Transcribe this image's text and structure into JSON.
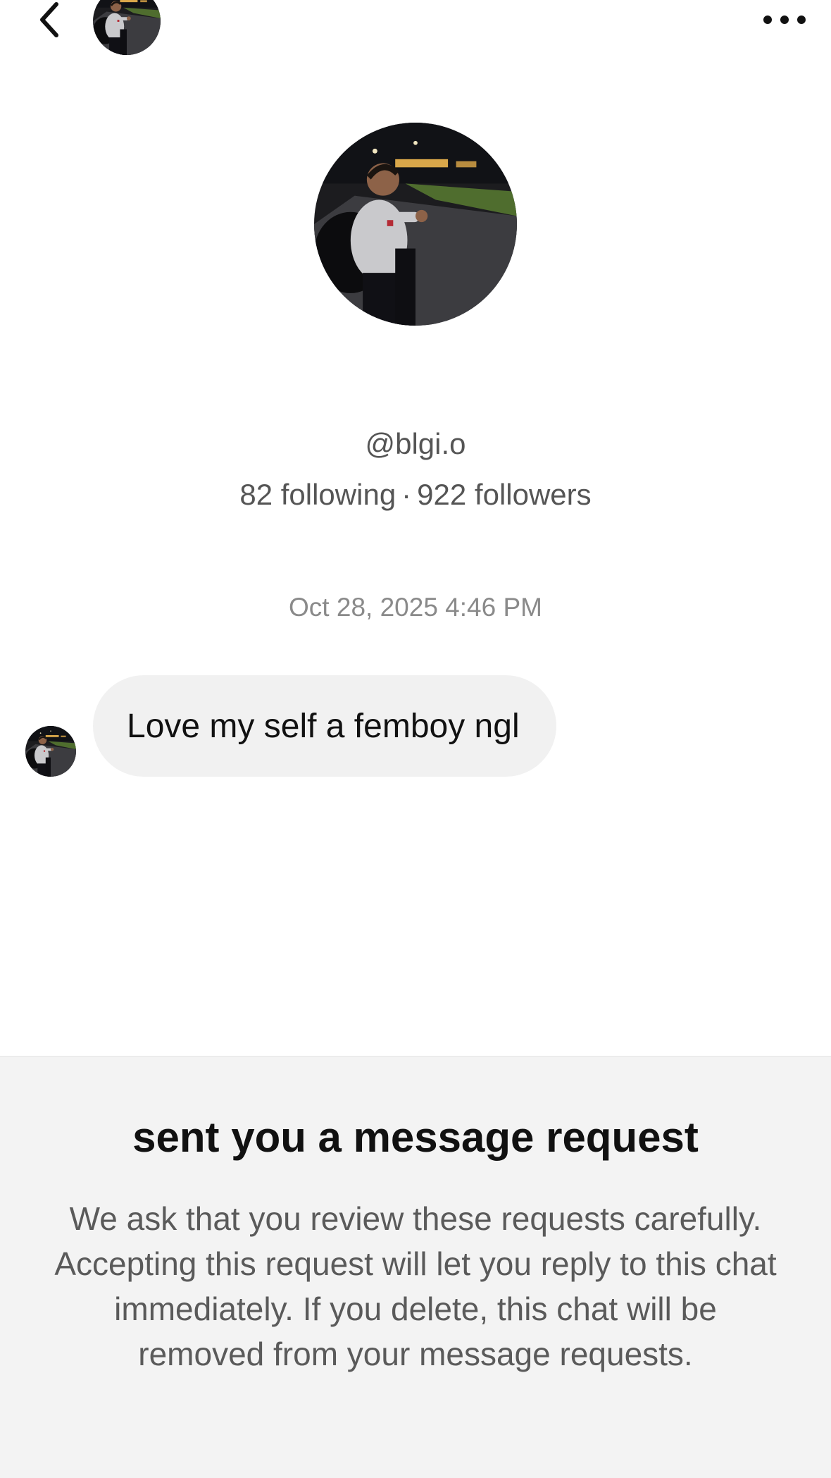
{
  "header": {
    "back_icon": "chevron-left-icon",
    "more_icon": "more-horizontal-icon"
  },
  "profile": {
    "username": "@blgi.o",
    "following": "82 following",
    "separator": "·",
    "followers": "922 followers"
  },
  "conversation": {
    "timestamp": "Oct 28, 2025 4:46 PM",
    "messages": [
      {
        "text": "Love my self a femboy ngl"
      }
    ]
  },
  "request": {
    "title": "sent you a message request",
    "body": "We ask that you review these requests carefully. Accepting this request will let you reply to this chat immediately. If you delete, this chat will be removed from your message requests."
  },
  "colors": {
    "bubble": "#f1f1f1",
    "panel": "#f3f3f3",
    "secondary_text": "#555555",
    "timestamp_text": "#8a8a8a"
  }
}
